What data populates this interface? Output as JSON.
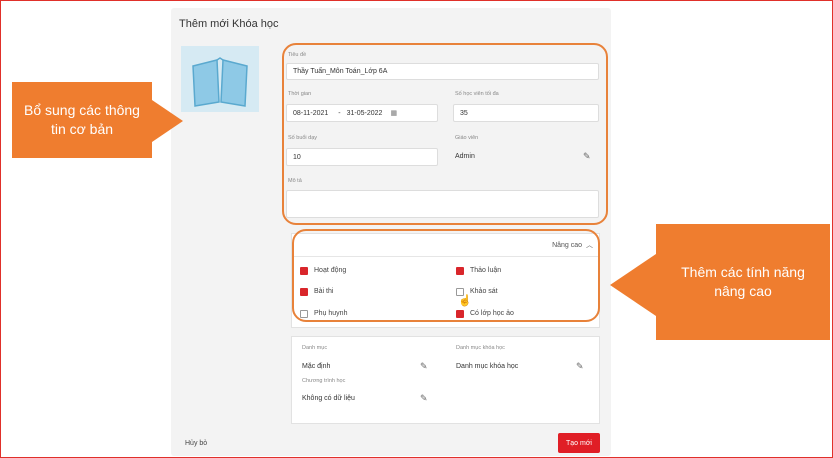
{
  "dialog": {
    "title": "Thêm mới Khóa học",
    "title_field": {
      "label": "Tiêu đề",
      "value": "Thầy Tuấn_Môn Toán_Lớp 6A"
    },
    "time": {
      "label": "Thời gian",
      "start": "08-11-2021",
      "separator": "-",
      "end": "31-05-2022"
    },
    "max_students": {
      "label": "Số học viên tối đa",
      "value": "35"
    },
    "sessions": {
      "label": "Số buổi dạy",
      "value": "10"
    },
    "teacher": {
      "label": "Giáo viên",
      "value": "Admin"
    },
    "description": {
      "label": "Mô tả",
      "value": ""
    },
    "advanced": {
      "toggle_label": "Nâng cao",
      "options": [
        {
          "label": "Hoạt động",
          "checked": true
        },
        {
          "label": "Thảo luận",
          "checked": true
        },
        {
          "label": "Bài thi",
          "checked": true
        },
        {
          "label": "Khảo sát",
          "checked": false
        },
        {
          "label": "Phụ huynh",
          "checked": false
        },
        {
          "label": "Có lớp học ảo",
          "checked": true
        }
      ]
    },
    "category": {
      "label": "Danh mục",
      "value": "Mặc định"
    },
    "course_category": {
      "label": "Danh mục khóa học",
      "value": "Danh mục khóa học"
    },
    "program": {
      "label": "Chương trình học",
      "value": "Không có dữ liệu"
    },
    "cancel_label": "Hủy bỏ",
    "create_label": "Tạo mới"
  },
  "callouts": {
    "left": "Bổ sung các thông tin cơ bản",
    "right": "Thêm các tính năng nâng cao"
  },
  "colors": {
    "accent": "#e01e26",
    "callout": "#ef7d2f",
    "callout_border": "#e8823a",
    "frame": "#e0302a"
  }
}
